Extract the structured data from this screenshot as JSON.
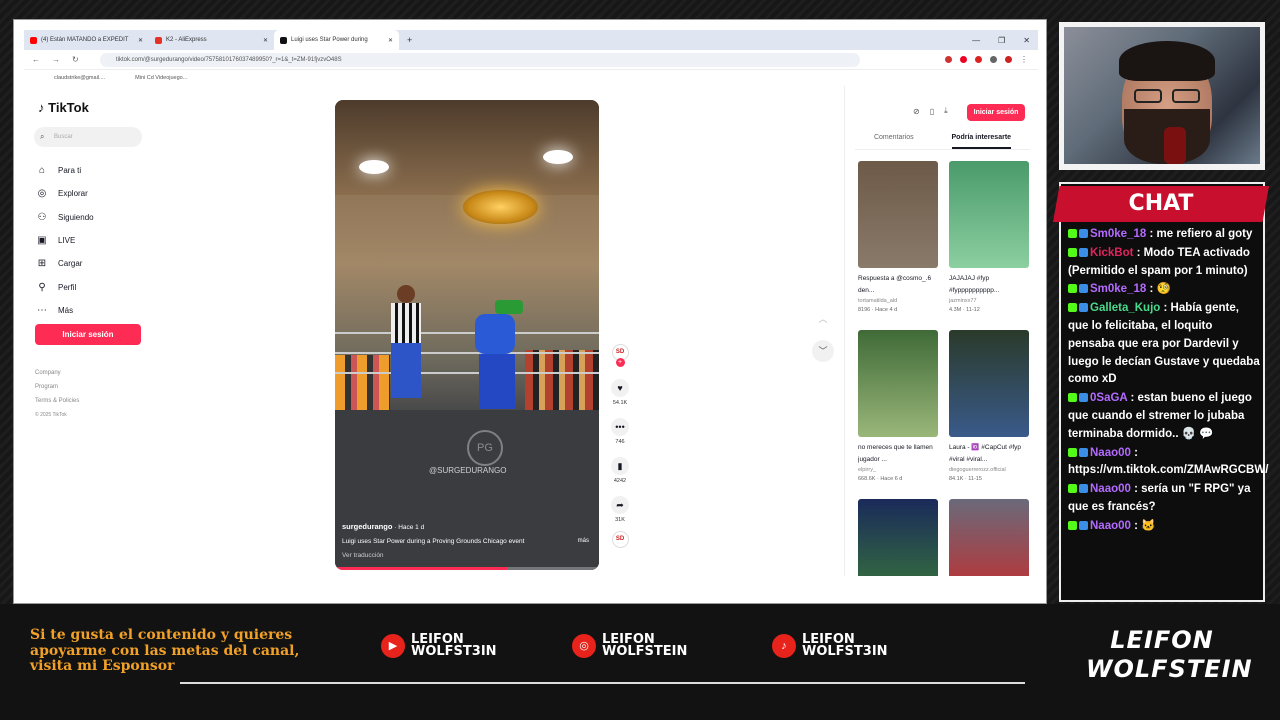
{
  "browser": {
    "tabs": [
      {
        "label": "(4) Están MATANDO a EXPEDIT"
      },
      {
        "label": "K2 - AliExpress"
      },
      {
        "label": "Luigi uses Star Power during"
      }
    ],
    "url": "tiktok.com/@surgedurango/video/7575810176037489950?_r=1&_t=ZM-91fjvzvO48S",
    "bookmarks": [
      "claudstrike@gmail....",
      "Mini Cd Videojuego..."
    ]
  },
  "tiktok": {
    "logo": "TikTok",
    "search_placeholder": "Buscar",
    "menu": [
      "Para ti",
      "Explorar",
      "Siguiendo",
      "LIVE",
      "Cargar",
      "Perfil",
      "Más"
    ],
    "login": "Iniciar sesión",
    "footer": [
      "Company",
      "Program",
      "Terms & Policies",
      "© 2025 TikTok"
    ],
    "video": {
      "handle": "@SURGEDURANGO",
      "author": "surgedurango",
      "time": "· Hace 1 d",
      "caption": "Luigi uses Star Power during a Proving Grounds Chicago event",
      "more": "más",
      "translate": "Ver traducción",
      "progress": 0.65
    },
    "actions": {
      "likes": "54.1K",
      "comments": "746",
      "saves": "4242",
      "shares": "31K",
      "avatar": "SD"
    },
    "right": {
      "login": "Iniciar sesión",
      "tabs": [
        "Comentarios",
        "Podría interesarte"
      ],
      "cards": [
        {
          "title": "Respuesta a @cosmo_.6 den...",
          "author": "tortamatilda_ald",
          "views": "8196",
          "date": "Hace 4 d",
          "color1": "#6d5a48",
          "color2": "#8a7a6a"
        },
        {
          "title": "JAJAJAJ #fyp #fypppppppppp...",
          "author": "jazminxx77",
          "views": "4.3M",
          "date": "11-12",
          "color1": "#4a9a6a",
          "color2": "#8ccfa0"
        },
        {
          "title": "no mereces que te llamen jugador ...",
          "author": "elpirry_",
          "views": "668.6K",
          "date": "Hace 6 d",
          "color1": "#3f6a37",
          "color2": "#9ab77a"
        },
        {
          "title": "Laura - 🆔 #CapCut #fyp #viral #viral...",
          "author": "diegoguerrerozz.official",
          "views": "84.1K",
          "date": "11-15",
          "color1": "#2a3a2a",
          "color2": "#3a5a8a"
        },
        {
          "title": "",
          "author": "",
          "views": "",
          "date": "",
          "color1": "#1a2a5a",
          "color2": "#3a7a3a"
        },
        {
          "title": "",
          "author": "",
          "views": "",
          "date": "",
          "color1": "#6a6a7a",
          "color2": "#c82a2a"
        }
      ]
    }
  },
  "chat": {
    "header": "CHAT",
    "messages": [
      {
        "user": "Sm0ke_18",
        "color": "#b36bff",
        "text": ": me refiero al goty"
      },
      {
        "user": "KickBot",
        "color": "#e0245e",
        "text": ": Modo TEA activado (Permitido el spam por 1 minuto)"
      },
      {
        "user": "Sm0ke_18",
        "color": "#b36bff",
        "text": ": 🧐"
      },
      {
        "user": "Galleta_Kujo",
        "color": "#4ad98b",
        "text": ": Había gente, que lo felicitaba, el loquito pensaba que era por Dardevil y luego le decían Gustave y quedaba como xD"
      },
      {
        "user": "0SaGA",
        "color": "#b36bff",
        "text": ": estan bueno el juego que cuando el stremer lo jubaba terminaba dormido.. 💀 💬"
      },
      {
        "user": "Naao00",
        "color": "#b36bff",
        "text": ": https://vm.tiktok.com/ZMAwRGCBW/"
      },
      {
        "user": "Naao00",
        "color": "#b36bff",
        "text": ": sería un \"F RPG\" ya que es francés?"
      },
      {
        "user": "Naao00",
        "color": "#b36bff",
        "text": ": 🐱"
      }
    ]
  },
  "overlay": {
    "sponsor_lines": [
      "Si te gusta el contenido y quieres",
      "apoyarme con las metas del canal,",
      "visita mi Esponsor"
    ],
    "socials": [
      {
        "icon": "youtube-icon",
        "line1": "LEIFON",
        "line2": "WOLFST3IN"
      },
      {
        "icon": "instagram-icon",
        "line1": "LEIFON",
        "line2": "WOLFSTEIN"
      },
      {
        "icon": "tiktok-icon",
        "line1": "LEIFON",
        "line2": "WOLFST3IN"
      }
    ],
    "brand_top": "LEIFON",
    "brand_bottom": "WOLFSTEIN"
  }
}
